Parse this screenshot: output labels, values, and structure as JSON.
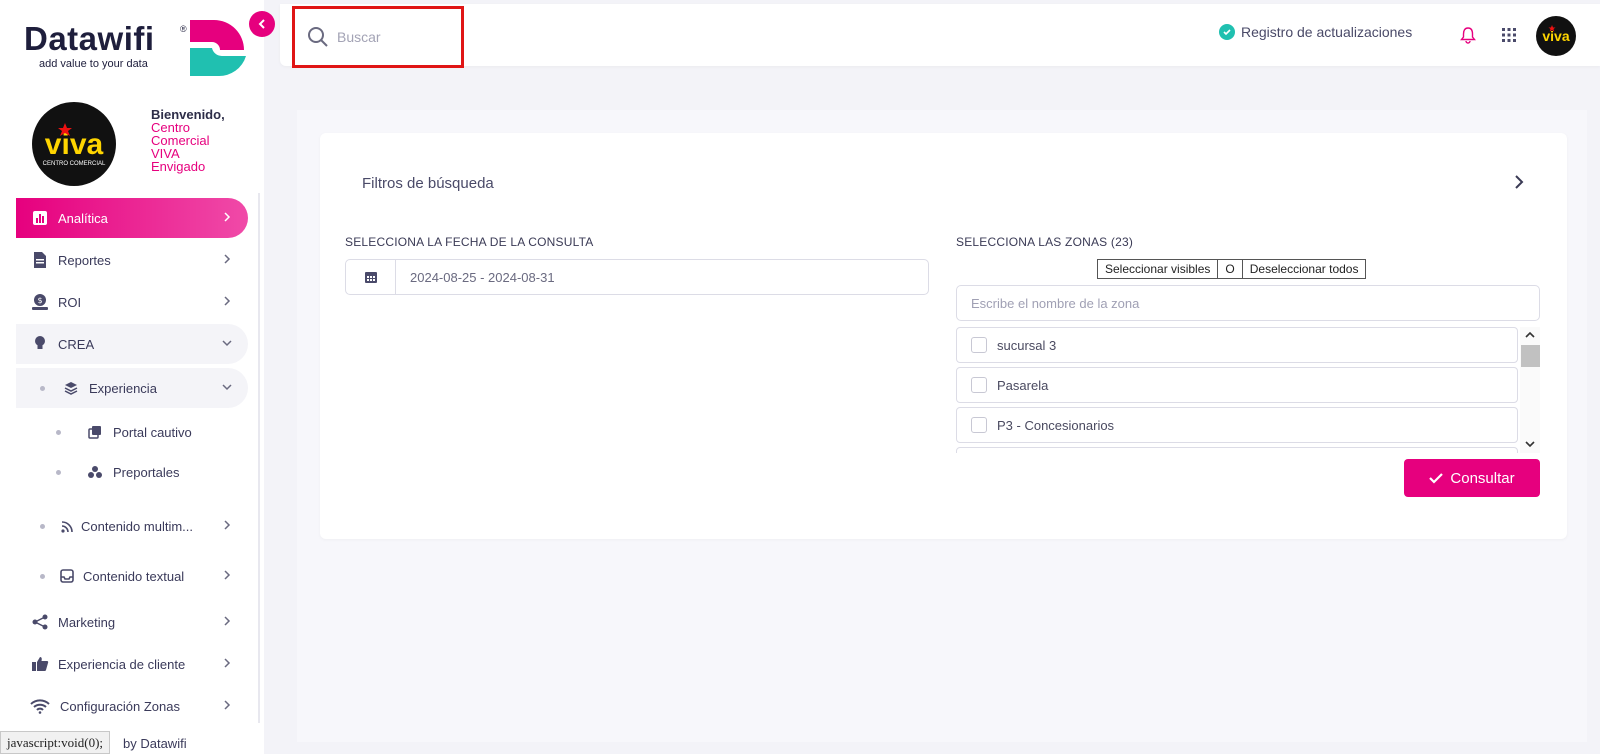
{
  "brand": {
    "name": "Datawifi",
    "tagline": "add value to your data",
    "registered": "®",
    "accent": "#e6007e",
    "accent2": "#20c0b0"
  },
  "welcome": {
    "greeting": "Bienvenido,",
    "line1": "Centro",
    "line2": "Comercial",
    "line3": "VIVA",
    "line4": "Envigado"
  },
  "sidebar": {
    "items": [
      {
        "label": "Analítica",
        "icon": "chart-icon"
      },
      {
        "label": "Reportes",
        "icon": "document-icon"
      },
      {
        "label": "ROI",
        "icon": "money-icon"
      },
      {
        "label": "CREA",
        "icon": "lightbulb-icon"
      },
      {
        "label": "Experiencia",
        "icon": "layers-icon"
      },
      {
        "label": "Portal cautivo",
        "icon": "copy-icon"
      },
      {
        "label": "Preportales",
        "icon": "cubes-icon"
      },
      {
        "label": "Contenido multim...",
        "icon": "rss-icon"
      },
      {
        "label": "Contenido textual",
        "icon": "inbox-icon"
      },
      {
        "label": "Marketing",
        "icon": "share-icon"
      },
      {
        "label": "Experiencia de cliente",
        "icon": "thumbs-up-icon"
      },
      {
        "label": "Configuración Zonas",
        "icon": "wifi-icon"
      }
    ],
    "footer": "by Datawifi"
  },
  "statusbar": {
    "text": "javascript:void(0);"
  },
  "topbar": {
    "search_placeholder": "Buscar",
    "updates_label": "Registro de actualizaciones"
  },
  "filters": {
    "title": "Filtros de búsqueda",
    "date_label": "SELECCIONA LA FECHA DE LA CONSULTA",
    "date_value": "2024-08-25 - 2024-08-31",
    "zones_label": "SELECCIONA LAS ZONAS (23)",
    "select_visible": "Seleccionar visibles",
    "or": "O",
    "deselect_all": "Deseleccionar todos",
    "zone_placeholder": "Escribe el nombre de la zona",
    "zones": [
      "sucursal 3",
      "Pasarela",
      "P3 - Concesionarios"
    ],
    "submit": "Consultar"
  }
}
